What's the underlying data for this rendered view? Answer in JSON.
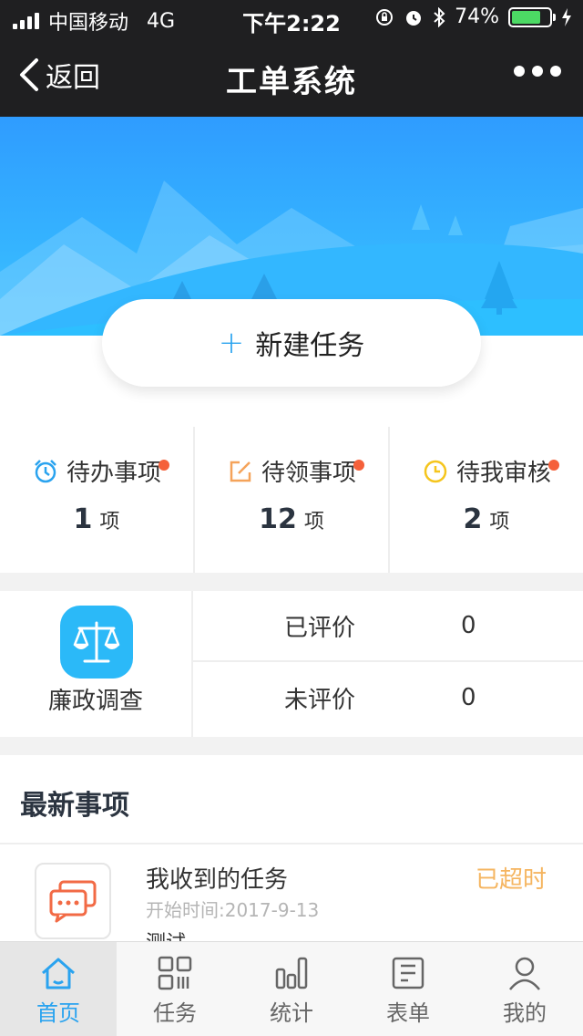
{
  "status_bar": {
    "carrier": "中国移动",
    "network": "4G",
    "time": "下午2:22",
    "battery": "74%"
  },
  "nav": {
    "back_label": "返回",
    "title": "工单系统"
  },
  "new_task": {
    "plus": "+",
    "label": "新建任务"
  },
  "stats": [
    {
      "label": "待办事项",
      "count": "1",
      "unit": "项"
    },
    {
      "label": "待领事项",
      "count": "12",
      "unit": "项"
    },
    {
      "label": "待我审核",
      "count": "2",
      "unit": "项"
    }
  ],
  "survey": {
    "name": "廉政调查",
    "rows": [
      {
        "label": "已评价",
        "value": "0"
      },
      {
        "label": "未评价",
        "value": "0"
      }
    ]
  },
  "latest": {
    "title": "最新事项",
    "items": [
      {
        "title": "我收到的任务",
        "time": "开始时间:2017-9-13",
        "desc": "测试",
        "status": "已超时"
      }
    ]
  },
  "tabs": [
    {
      "label": "首页"
    },
    {
      "label": "任务"
    },
    {
      "label": "统计"
    },
    {
      "label": "表单"
    },
    {
      "label": "我的"
    }
  ],
  "colors": {
    "accent": "#2aa3ef",
    "badge": "#f5603a",
    "overdue": "#f5b560",
    "nav_bg": "#1f1f21"
  }
}
